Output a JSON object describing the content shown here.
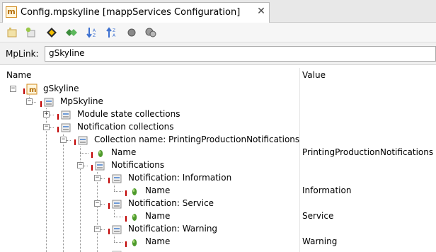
{
  "tab": {
    "icon_letter": "m",
    "title": "Config.mpskyline [mappServices Configuration]",
    "close": "✕"
  },
  "toolbar": {
    "buttons": [
      "new-icon",
      "add-icon",
      "move-icon",
      "expand-icon",
      "sort-desc-icon",
      "sort-asc-icon",
      "circle-icon",
      "gears-icon"
    ]
  },
  "mplink": {
    "label": "MpLink:",
    "value": "gSkyline"
  },
  "columns": {
    "name": "Name",
    "value": "Value"
  },
  "tree": [
    {
      "label": "gSkyline",
      "value": ""
    },
    {
      "label": "MpSkyline",
      "value": ""
    },
    {
      "label": "Module state collections",
      "value": ""
    },
    {
      "label": "Notification collections",
      "value": ""
    },
    {
      "label": "Collection name: PrintingProductionNotifications",
      "value": ""
    },
    {
      "label": "Name",
      "value": "PrintingProductionNotifications"
    },
    {
      "label": "Notifications",
      "value": ""
    },
    {
      "label": "Notification: Information",
      "value": ""
    },
    {
      "label": "Name",
      "value": "Information"
    },
    {
      "label": "Notification: Service",
      "value": ""
    },
    {
      "label": "Name",
      "value": "Service"
    },
    {
      "label": "Notification: Warning",
      "value": ""
    },
    {
      "label": "Name",
      "value": "Warning"
    }
  ]
}
